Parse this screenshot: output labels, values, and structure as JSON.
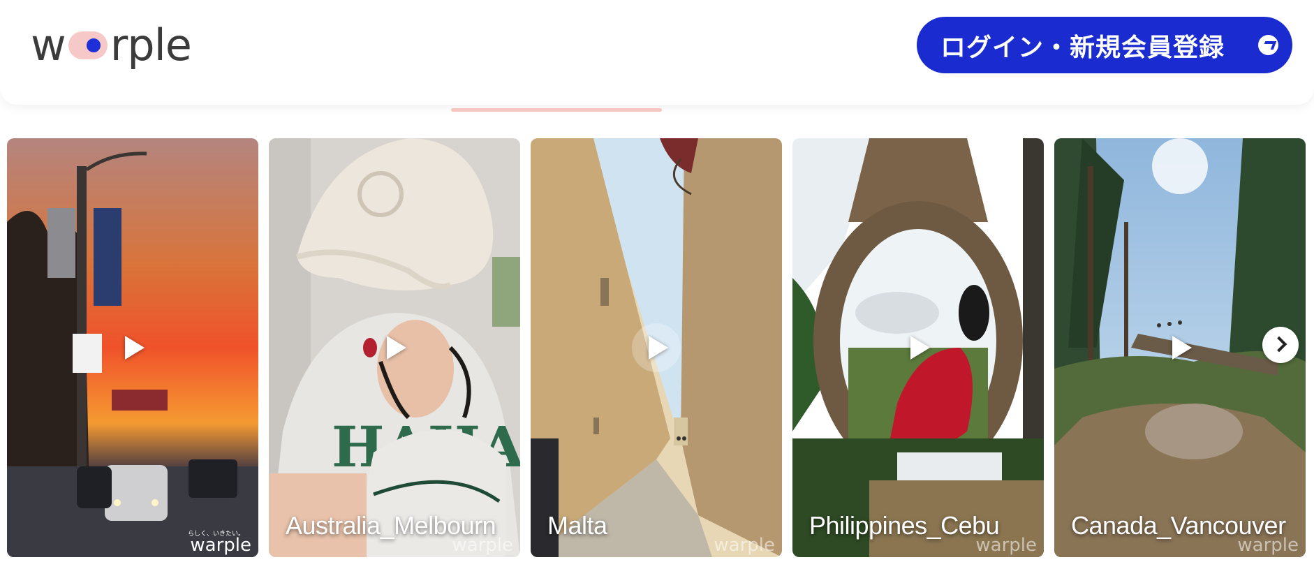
{
  "header": {
    "logo_text_left": "w",
    "logo_text_right": "rple",
    "login_label": "ログイン・新規会員登録",
    "login_icon": "arrow-right-circle-icon"
  },
  "colors": {
    "accent": "#1a2ccf",
    "logo_pink": "#f7c8c8",
    "logo_blue": "#1e2fd8",
    "tab_indicator": "#f5c6c0"
  },
  "cards": [
    {
      "title": "",
      "watermark": "warple",
      "tagline": "らしく、いきたい。",
      "play_icon": "play-icon"
    },
    {
      "title": "Australia_Melbourn",
      "watermark": "warple",
      "play_icon": "play-icon"
    },
    {
      "title": "Malta",
      "watermark": "warple",
      "play_icon": "play-icon"
    },
    {
      "title": "Philippines_Cebu",
      "watermark": "warple",
      "play_icon": "play-icon"
    },
    {
      "title": "Canada_Vancouver",
      "watermark": "warple",
      "play_icon": "play-icon"
    }
  ],
  "carousel": {
    "next_icon": "chevron-right-icon"
  }
}
